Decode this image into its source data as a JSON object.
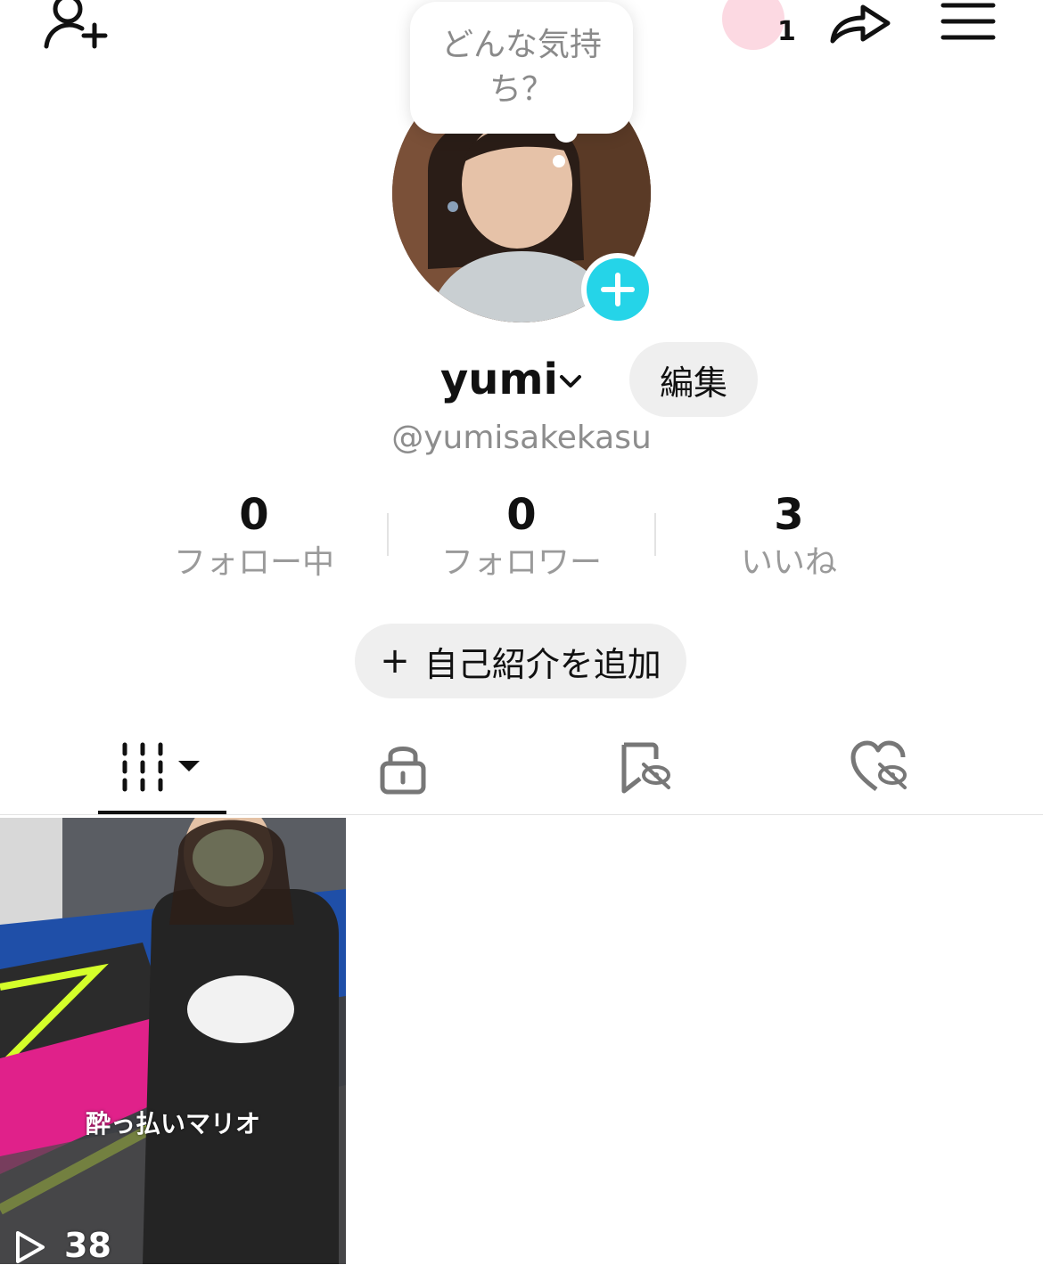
{
  "header": {
    "story_count": "1",
    "mood_prompt": "どんな気持ち？"
  },
  "profile": {
    "username": "yumi",
    "handle": "@yumisakekasu",
    "edit_label": "編集"
  },
  "stats": [
    {
      "value": "0",
      "label": "フォロー中"
    },
    {
      "value": "0",
      "label": "フォロワー"
    },
    {
      "value": "3",
      "label": "いいね"
    }
  ],
  "bio": {
    "add_label": "自己紹介を追加",
    "plus": "+"
  },
  "tabs": [
    {
      "name": "videos",
      "icon": "grid-icon",
      "active": true
    },
    {
      "name": "private",
      "icon": "lock-icon"
    },
    {
      "name": "bookmarks",
      "icon": "bookmark-hidden-icon"
    },
    {
      "name": "liked",
      "icon": "heart-hidden-icon"
    }
  ],
  "videos": [
    {
      "caption": "酔っ払いマリオ",
      "views": "38"
    }
  ],
  "colors": {
    "accent": "#25d4e8",
    "story_ring": "#fcd9e2",
    "button_bg": "#efefef",
    "muted_text": "#8d8d8d"
  }
}
